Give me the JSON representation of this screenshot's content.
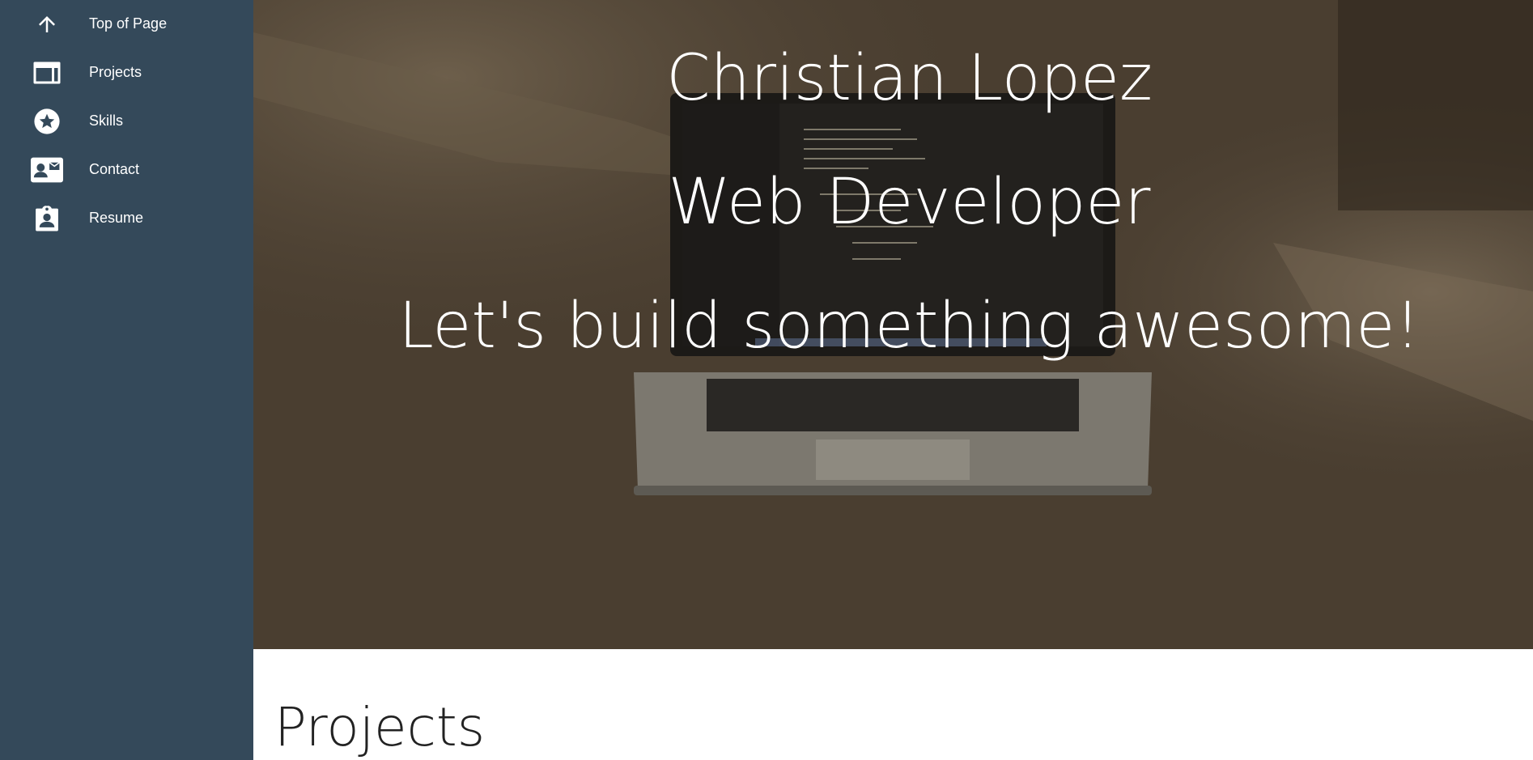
{
  "sidebar": {
    "items": [
      {
        "label": "Top of Page",
        "icon": "arrow-up-icon"
      },
      {
        "label": "Projects",
        "icon": "web-icon"
      },
      {
        "label": "Skills",
        "icon": "star-circle-icon"
      },
      {
        "label": "Contact",
        "icon": "contact-card-icon"
      },
      {
        "label": "Resume",
        "icon": "clipboard-account-icon"
      }
    ]
  },
  "hero": {
    "name": "Christian Lopez",
    "role": "Web Developer",
    "tagline": "Let's build something awesome!"
  },
  "projects": {
    "title": "Projects"
  },
  "colors": {
    "sidebar": "#34495a",
    "text_light": "#ffffff"
  }
}
